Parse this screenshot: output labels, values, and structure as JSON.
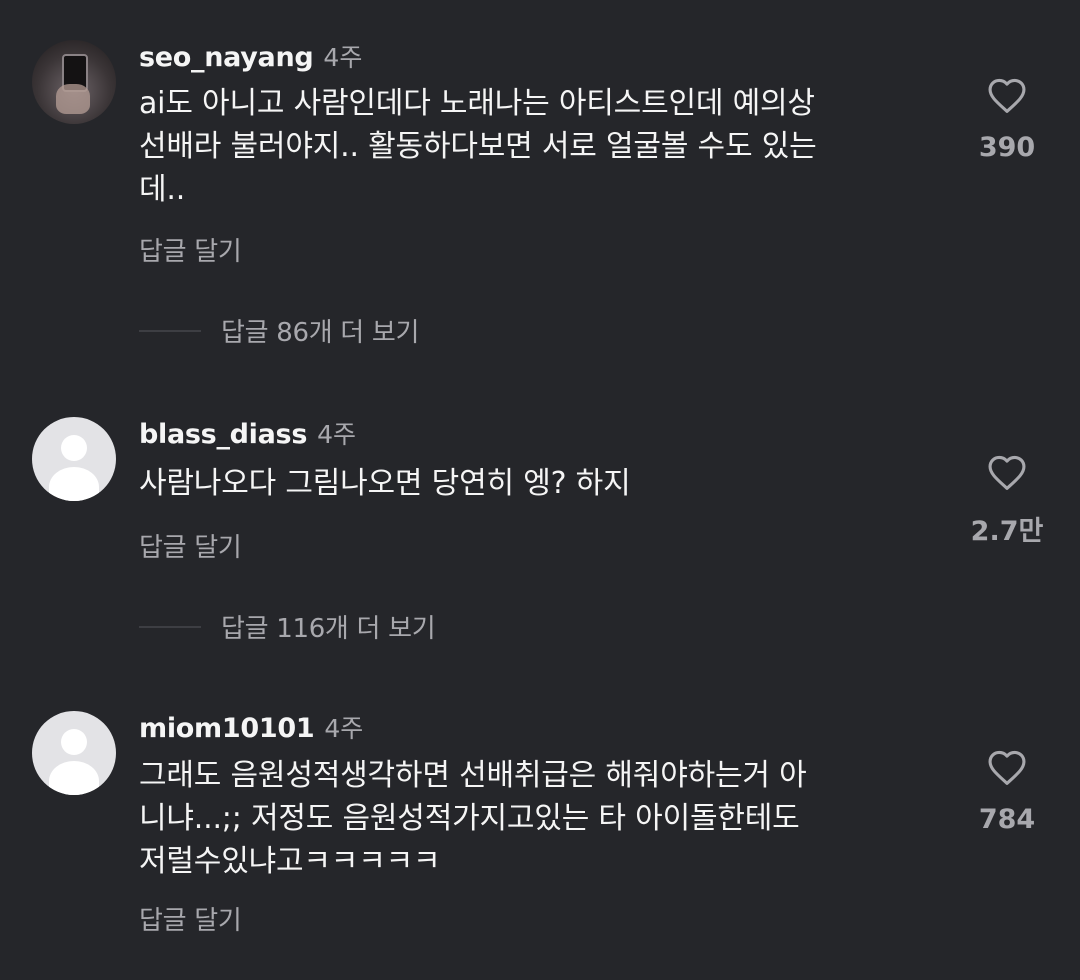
{
  "comments": [
    {
      "username": "seo_nayang",
      "time": "4주",
      "lines": [
        "ai도 아니고 사람인데다 노래나는 아티스트인데 예의상",
        "선배라 불러야지.. 활동하다보면 서로 얼굴볼 수도 있는",
        "데.."
      ],
      "reply_label": "답글 달기",
      "likes": "390",
      "more_replies": "답글 86개 더 보기",
      "avatar": "photo"
    },
    {
      "username": "blass_diass",
      "time": "4주",
      "lines": [
        "사람나오다 그림나오면 당연히 엥? 하지"
      ],
      "reply_label": "답글 달기",
      "likes": "2.7만",
      "more_replies": "답글 116개 더 보기",
      "avatar": "default"
    },
    {
      "username": "miom10101",
      "time": "4주",
      "lines": [
        "그래도 음원성적생각하면 선배취급은 해줘야하는거 아",
        "니냐...;; 저정도 음원성적가지고있는 타 아이돌한테도",
        "저럴수있냐고ㅋㅋㅋㅋㅋ"
      ],
      "reply_label": "답글 달기",
      "likes": "784",
      "avatar": "default"
    }
  ],
  "colors": {
    "background": "#25262a",
    "primary_text": "#f5f5f5",
    "secondary_text": "#a8a8ad"
  },
  "icons": {
    "like": "heart-outline-icon",
    "avatar_default": "default-avatar-icon"
  }
}
